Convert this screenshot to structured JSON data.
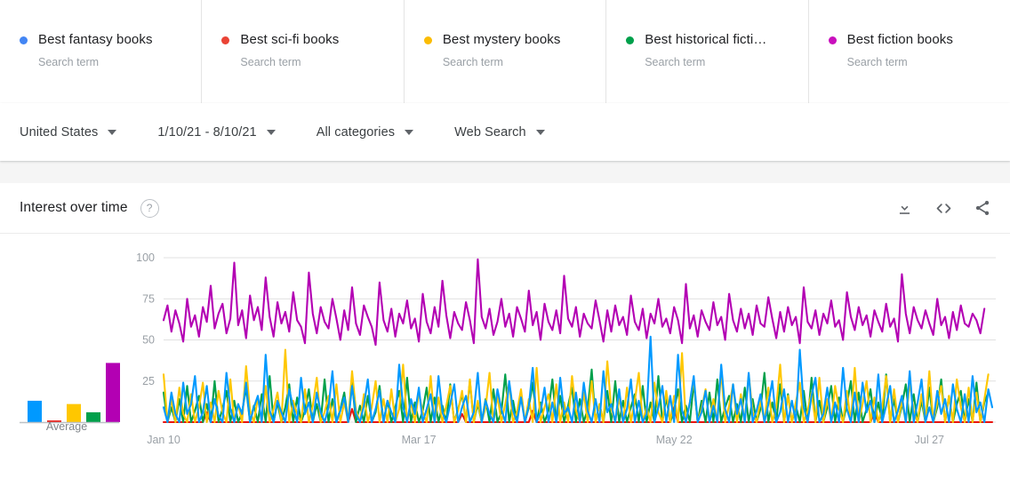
{
  "legend": {
    "sub_label": "Search term",
    "items": [
      {
        "label": "Best fantasy books",
        "sub": "Search term",
        "color": "#4285F4",
        "line_color": "#0099FF"
      },
      {
        "label": "Best sci-fi books",
        "sub": "Search term",
        "color": "#EA4335",
        "line_color": "#E8140F"
      },
      {
        "label": "Best mystery books",
        "sub": "Search term",
        "color": "#FBBC04",
        "line_color": "#FFC700"
      },
      {
        "label": "Best historical ficti…",
        "sub": "Search term",
        "color": "#00A04B",
        "line_color": "#00A04B"
      },
      {
        "label": "Best fiction books",
        "sub": "Search term",
        "color": "#C90FBD",
        "line_color": "#B300B3"
      }
    ]
  },
  "filters": [
    {
      "name": "region",
      "label": "United States"
    },
    {
      "name": "date-range",
      "label": "1/10/21 - 8/10/21"
    },
    {
      "name": "category",
      "label": "All categories"
    },
    {
      "name": "search-type",
      "label": "Web Search"
    }
  ],
  "card": {
    "title": "Interest over time",
    "help_glyph": "?",
    "actions": [
      {
        "name": "download-icon",
        "title": "Download"
      },
      {
        "name": "embed-icon",
        "title": "Embed"
      },
      {
        "name": "share-icon",
        "title": "Share"
      }
    ]
  },
  "chart_data": {
    "type": "line",
    "title": "Interest over time",
    "xlabel": "",
    "ylabel": "",
    "ylim": [
      0,
      100
    ],
    "yticks": [
      100,
      75,
      50,
      25
    ],
    "grid": true,
    "legend_position": "top",
    "x_tick_labels": [
      "Jan 10",
      "Mar 17",
      "May 22",
      "Jul 27"
    ],
    "x_tick_index": [
      0,
      65,
      130,
      195
    ],
    "n_points": 212,
    "average_label": "Average",
    "averages": [
      13,
      1,
      11,
      6,
      36
    ],
    "series": [
      {
        "name": "Best fantasy books",
        "color": "#0099FF",
        "average": 13,
        "values": [
          9,
          0,
          18,
          5,
          0,
          24,
          5,
          11,
          28,
          0,
          6,
          22,
          0,
          14,
          4,
          0,
          30,
          8,
          0,
          11,
          5,
          24,
          0,
          9,
          16,
          0,
          41,
          7,
          0,
          13,
          6,
          0,
          20,
          9,
          0,
          27,
          5,
          12,
          0,
          18,
          6,
          0,
          9,
          31,
          0,
          7,
          15,
          0,
          22,
          5,
          0,
          10,
          26,
          0,
          8,
          19,
          0,
          13,
          6,
          0,
          35,
          9,
          0,
          14,
          5,
          21,
          0,
          8,
          17,
          0,
          28,
          6,
          0,
          11,
          23,
          0,
          9,
          16,
          0,
          6,
          30,
          0,
          13,
          5,
          0,
          20,
          8,
          0,
          25,
          7,
          0,
          15,
          0,
          10,
          33,
          0,
          6,
          21,
          0,
          12,
          0,
          27,
          5,
          9,
          0,
          18,
          0,
          24,
          7,
          0,
          14,
          0,
          31,
          6,
          11,
          0,
          20,
          0,
          8,
          26,
          0,
          13,
          0,
          5,
          52,
          0,
          9,
          22,
          0,
          16,
          0,
          41,
          7,
          0,
          12,
          28,
          0,
          6,
          19,
          0,
          10,
          0,
          35,
          8,
          0,
          23,
          5,
          14,
          0,
          30,
          0,
          7,
          17,
          0,
          11,
          25,
          0,
          6,
          20,
          0,
          13,
          0,
          44,
          9,
          0,
          16,
          27,
          0,
          5,
          21,
          0,
          12,
          0,
          33,
          8,
          0,
          18,
          0,
          24,
          6,
          13,
          0,
          29,
          0,
          10,
          22,
          0,
          7,
          16,
          0,
          31,
          0,
          12,
          26,
          0,
          9,
          0,
          19,
          5,
          14,
          0,
          23,
          8,
          0,
          17,
          0,
          28,
          6,
          12,
          0,
          20,
          9,
          0,
          15,
          22,
          0,
          11,
          18
        ]
      },
      {
        "name": "Best sci-fi books",
        "color": "#E8140F",
        "average": 1,
        "values": [
          0,
          0,
          0,
          0,
          0,
          0,
          0,
          0,
          0,
          0,
          0,
          6,
          0,
          0,
          0,
          0,
          0,
          0,
          0,
          0,
          0,
          0,
          0,
          0,
          0,
          0,
          0,
          0,
          0,
          0,
          0,
          0,
          0,
          0,
          0,
          0,
          0,
          0,
          0,
          0,
          0,
          0,
          0,
          0,
          0,
          0,
          0,
          0,
          8,
          0,
          0,
          0,
          0,
          0,
          0,
          0,
          0,
          0,
          0,
          0,
          0,
          0,
          0,
          0,
          0,
          0,
          0,
          0,
          0,
          0,
          0,
          0,
          0,
          0,
          0,
          0,
          5,
          0,
          0,
          0,
          0,
          0,
          0,
          0,
          0,
          0,
          0,
          0,
          0,
          0,
          0,
          0,
          0,
          0,
          7,
          0,
          0,
          0,
          0,
          0,
          0,
          0,
          0,
          0,
          0,
          0,
          0,
          0,
          0,
          0,
          0,
          0,
          0,
          0,
          0,
          0,
          0,
          0,
          0,
          0,
          0,
          0,
          0,
          0,
          0,
          0,
          0,
          0,
          0,
          0,
          9,
          0,
          0,
          0,
          0,
          0,
          0,
          0,
          0,
          0,
          0,
          0,
          0,
          0,
          0,
          0,
          0,
          0,
          0,
          0,
          0,
          0,
          0,
          0,
          0,
          0,
          0,
          0,
          0,
          0,
          0,
          0,
          0,
          0,
          0,
          0,
          0,
          0,
          0,
          0,
          0,
          0,
          0,
          0,
          0,
          0,
          0,
          0,
          0,
          0,
          0,
          6,
          0,
          0,
          0,
          0,
          0,
          0,
          0,
          0,
          0,
          0,
          0,
          0,
          0,
          0,
          0,
          0,
          0,
          0,
          0,
          0,
          0,
          0,
          0,
          0,
          0,
          0,
          0,
          0,
          0,
          0
        ]
      },
      {
        "name": "Best mystery books",
        "color": "#FFC700",
        "average": 11,
        "values": [
          29,
          0,
          14,
          0,
          21,
          5,
          0,
          17,
          0,
          9,
          24,
          0,
          12,
          0,
          19,
          6,
          0,
          26,
          0,
          11,
          0,
          34,
          7,
          0,
          15,
          0,
          22,
          0,
          8,
          18,
          0,
          44,
          0,
          13,
          5,
          0,
          20,
          0,
          10,
          27,
          0,
          6,
          16,
          0,
          23,
          0,
          12,
          0,
          31,
          7,
          0,
          17,
          0,
          9,
          25,
          0,
          14,
          0,
          20,
          0,
          8,
          35,
          0,
          12,
          0,
          18,
          6,
          0,
          28,
          0,
          15,
          0,
          10,
          22,
          0,
          7,
          19,
          0,
          26,
          0,
          13,
          0,
          9,
          30,
          0,
          16,
          0,
          11,
          24,
          0,
          6,
          20,
          0,
          14,
          0,
          33,
          0,
          9,
          17,
          0,
          23,
          0,
          12,
          0,
          28,
          7,
          0,
          18,
          0,
          25,
          0,
          11,
          0,
          37,
          8,
          0,
          15,
          0,
          21,
          0,
          13,
          30,
          0,
          9,
          0,
          24,
          6,
          0,
          19,
          0,
          16,
          0,
          42,
          0,
          12,
          26,
          0,
          8,
          20,
          0,
          14,
          0,
          31,
          0,
          10,
          23,
          0,
          17,
          0,
          29,
          6,
          0,
          13,
          0,
          21,
          0,
          9,
          35,
          0,
          16,
          0,
          12,
          24,
          0,
          7,
          18,
          0,
          27,
          0,
          14,
          0,
          22,
          8,
          0,
          19,
          0,
          33,
          0,
          11,
          25,
          0,
          15,
          0,
          9,
          28,
          0,
          20,
          0,
          13,
          0,
          24,
          7,
          0,
          17,
          0,
          31,
          0,
          12,
          22,
          0,
          16,
          0,
          26,
          9,
          0,
          21,
          0,
          18,
          0,
          14,
          29
        ]
      },
      {
        "name": "Best historical fiction books",
        "color": "#00A04B",
        "average": 6,
        "values": [
          18,
          0,
          9,
          0,
          14,
          0,
          22,
          0,
          7,
          16,
          0,
          11,
          0,
          25,
          0,
          8,
          19,
          0,
          13,
          0,
          6,
          21,
          0,
          10,
          0,
          17,
          0,
          28,
          0,
          12,
          0,
          9,
          23,
          0,
          15,
          0,
          7,
          20,
          0,
          11,
          0,
          26,
          0,
          14,
          0,
          8,
          18,
          0,
          24,
          0,
          10,
          0,
          16,
          0,
          6,
          22,
          0,
          13,
          0,
          9,
          19,
          0,
          27,
          0,
          12,
          0,
          7,
          21,
          0,
          15,
          0,
          10,
          0,
          23,
          0,
          8,
          17,
          0,
          25,
          0,
          11,
          0,
          14,
          0,
          20,
          0,
          6,
          29,
          0,
          13,
          0,
          18,
          0,
          9,
          24,
          0,
          12,
          0,
          7,
          26,
          0,
          16,
          0,
          10,
          21,
          0,
          14,
          0,
          8,
          32,
          0,
          11,
          0,
          19,
          0,
          25,
          0,
          13,
          0,
          9,
          17,
          0,
          22,
          0,
          12,
          0,
          28,
          0,
          15,
          0,
          7,
          20,
          0,
          10,
          0,
          24,
          0,
          13,
          0,
          18,
          0,
          26,
          0,
          9,
          16,
          0,
          11,
          0,
          21,
          0,
          14,
          0,
          8,
          30,
          0,
          12,
          0,
          23,
          0,
          17,
          0,
          10,
          0,
          19,
          0,
          27,
          0,
          13,
          0,
          9,
          22,
          0,
          15,
          0,
          11,
          25,
          0,
          18,
          0,
          8,
          20,
          0,
          12,
          0,
          29,
          0,
          14,
          0,
          10,
          23,
          0,
          17,
          0,
          13,
          0,
          21,
          0,
          9,
          26,
          0,
          16,
          0,
          11,
          19,
          0,
          14,
          0,
          24,
          0,
          12,
          18
        ]
      },
      {
        "name": "Best fiction books",
        "color": "#B300B3",
        "average": 36,
        "values": [
          62,
          71,
          55,
          68,
          60,
          49,
          75,
          58,
          65,
          52,
          70,
          61,
          83,
          57,
          66,
          72,
          54,
          63,
          97,
          59,
          68,
          51,
          77,
          62,
          70,
          56,
          88,
          64,
          52,
          73,
          60,
          67,
          55,
          79,
          62,
          58,
          48,
          91,
          66,
          54,
          70,
          61,
          57,
          75,
          63,
          50,
          68,
          56,
          82,
          60,
          53,
          71,
          64,
          58,
          47,
          85,
          62,
          55,
          69,
          52,
          66,
          60,
          74,
          57,
          63,
          49,
          78,
          61,
          54,
          70,
          58,
          86,
          65,
          51,
          67,
          60,
          56,
          73,
          62,
          48,
          99,
          64,
          57,
          69,
          53,
          61,
          75,
          58,
          66,
          52,
          70,
          63,
          55,
          80,
          59,
          67,
          50,
          72,
          61,
          56,
          68,
          54,
          89,
          63,
          58,
          70,
          52,
          66,
          60,
          57,
          74,
          62,
          49,
          68,
          55,
          71,
          59,
          64,
          53,
          77,
          61,
          56,
          69,
          51,
          66,
          60,
          75,
          58,
          63,
          54,
          70,
          62,
          48,
          84,
          57,
          65,
          52,
          68,
          61,
          56,
          73,
          59,
          64,
          50,
          78,
          62,
          55,
          69,
          57,
          66,
          53,
          71,
          60,
          58,
          76,
          63,
          51,
          67,
          55,
          70,
          59,
          64,
          48,
          82,
          61,
          57,
          68,
          53,
          66,
          60,
          74,
          58,
          62,
          50,
          79,
          64,
          56,
          70,
          59,
          65,
          52,
          68,
          61,
          55,
          72,
          58,
          63,
          49,
          90,
          66,
          54,
          70,
          62,
          57,
          68,
          60,
          53,
          75,
          59,
          64,
          51,
          67,
          56,
          71,
          60,
          58,
          66,
          62,
          54,
          69
        ]
      }
    ]
  }
}
